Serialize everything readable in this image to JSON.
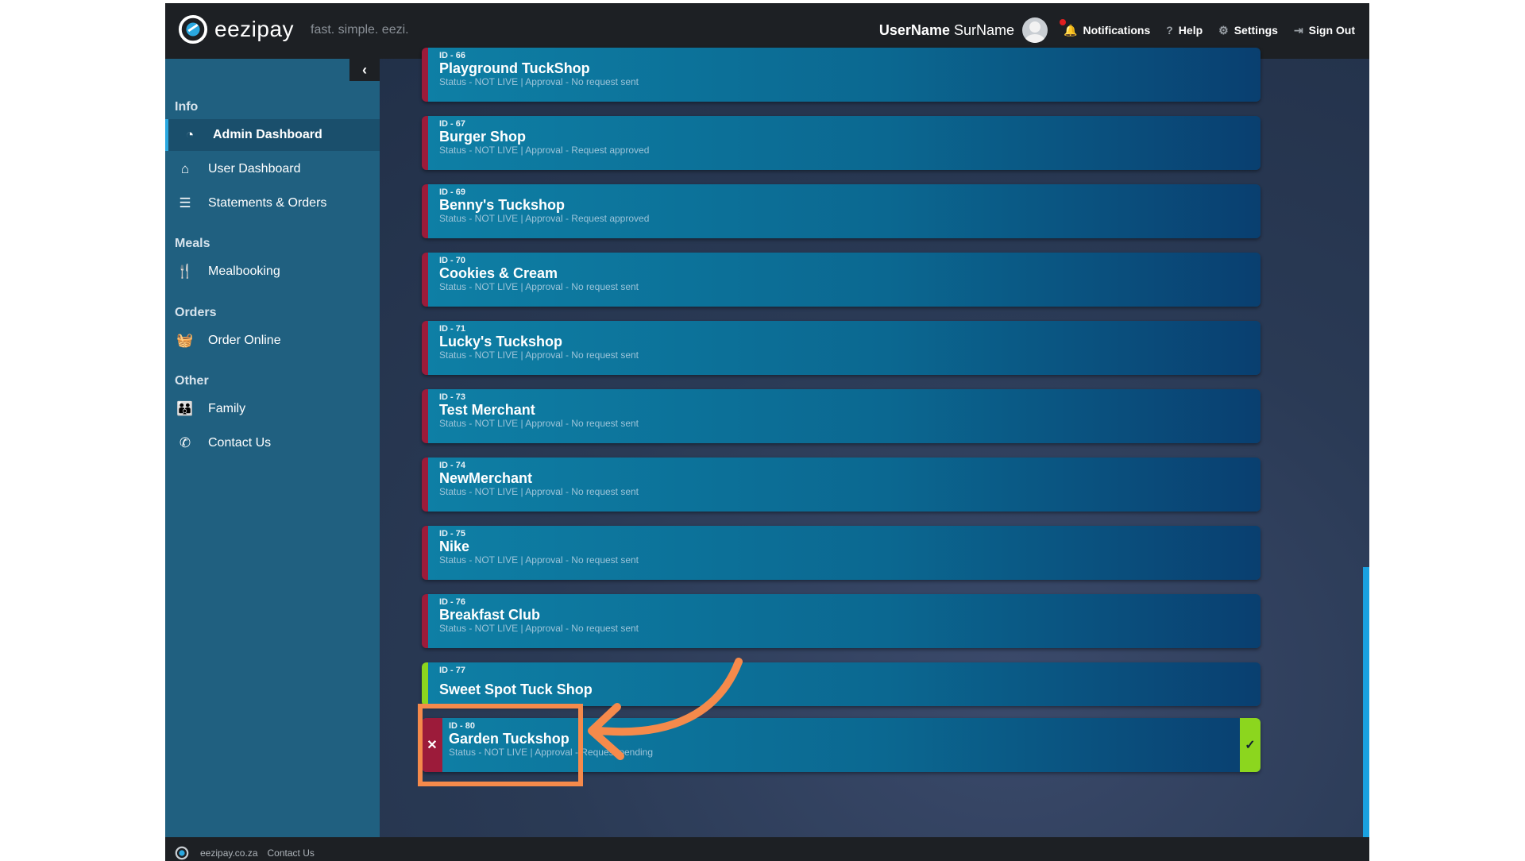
{
  "header": {
    "brand": "eezipay",
    "tagline": "fast. simple. eezi.",
    "user_first": "UserName",
    "user_last": "SurName",
    "notifications": "Notifications",
    "help": "Help",
    "settings": "Settings",
    "signout": "Sign Out"
  },
  "sidebar": {
    "collapse_icon": "chevron-left-icon",
    "sections": [
      {
        "title": "Info"
      },
      {
        "title": "Meals"
      },
      {
        "title": "Orders"
      },
      {
        "title": "Other"
      }
    ],
    "items": [
      {
        "label": "Admin Dashboard",
        "icon": "dashboard-icon",
        "active": true
      },
      {
        "label": "User Dashboard",
        "icon": "home-icon"
      },
      {
        "label": "Statements & Orders",
        "icon": "list-icon"
      },
      {
        "label": "Mealbooking",
        "icon": "cutlery-icon"
      },
      {
        "label": "Order Online",
        "icon": "basket-icon"
      },
      {
        "label": "Family",
        "icon": "family-icon"
      },
      {
        "label": "Contact Us",
        "icon": "phone-icon"
      }
    ]
  },
  "merchants": [
    {
      "id": "ID - 66",
      "name": "Playground TuckShop",
      "status": "Status - NOT LIVE | Approval - No request sent"
    },
    {
      "id": "ID - 67",
      "name": "Burger Shop",
      "status": "Status - NOT LIVE | Approval - Request approved"
    },
    {
      "id": "ID - 69",
      "name": "Benny's Tuckshop",
      "status": "Status - NOT LIVE | Approval - Request approved"
    },
    {
      "id": "ID - 70",
      "name": "Cookies & Cream",
      "status": "Status - NOT LIVE | Approval - No request sent"
    },
    {
      "id": "ID - 71",
      "name": "Lucky's Tuckshop",
      "status": "Status - NOT LIVE | Approval - No request sent"
    },
    {
      "id": "ID - 73",
      "name": "Test Merchant",
      "status": "Status - NOT LIVE | Approval - No request sent"
    },
    {
      "id": "ID - 74",
      "name": "NewMerchant",
      "status": "Status - NOT LIVE | Approval - No request sent"
    },
    {
      "id": "ID - 75",
      "name": "Nike",
      "status": "Status - NOT LIVE | Approval - No request sent"
    },
    {
      "id": "ID - 76",
      "name": "Breakfast Club",
      "status": "Status - NOT LIVE | Approval - No request sent"
    },
    {
      "id": "ID - 77",
      "name": "Sweet Spot Tuck Shop",
      "status": ""
    },
    {
      "id": "ID - 80",
      "name": "Garden Tuckshop",
      "status": "Status - NOT LIVE | Approval - Request pending"
    }
  ],
  "selected_actions": {
    "reject": "✕",
    "approve": "✓"
  },
  "footer": {
    "site": "eezipay.co.za",
    "contact": "Contact Us"
  },
  "colors": {
    "accent": "#2aa8e0",
    "sidebar": "#206080",
    "card_reject": "#9c1b3a",
    "card_approve": "#8cd61e",
    "highlight": "#f58a4b"
  }
}
